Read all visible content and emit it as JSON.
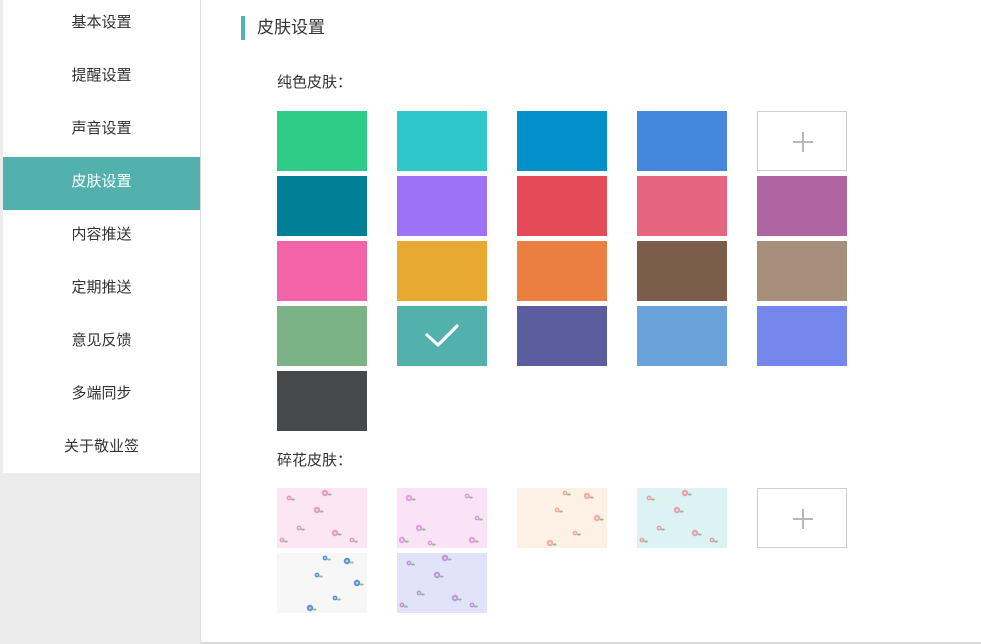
{
  "sidebar": {
    "items": [
      {
        "label": "基本设置",
        "active": false
      },
      {
        "label": "提醒设置",
        "active": false
      },
      {
        "label": "声音设置",
        "active": false
      },
      {
        "label": "皮肤设置",
        "active": true
      },
      {
        "label": "内容推送",
        "active": false
      },
      {
        "label": "定期推送",
        "active": false
      },
      {
        "label": "意见反馈",
        "active": false
      },
      {
        "label": "多端同步",
        "active": false
      },
      {
        "label": "关于敬业签",
        "active": false
      }
    ],
    "accent_color": "#52b1ad"
  },
  "main": {
    "title": "皮肤设置",
    "solid_section": {
      "label": "纯色皮肤：",
      "colors": [
        "#2ecc87",
        "#2fc7c9",
        "#028fca",
        "#4587dc",
        "add",
        "#007f97",
        "#9e71f5",
        "#e54b57",
        "#e5647f",
        "#ae65a1",
        "#f264a7",
        "#e8a933",
        "#eb7e41",
        "#7b5d4a",
        "#a88f7b",
        "#7bb286",
        "#52b1ad",
        "#5b5d9f",
        "#6aa2dc",
        "#7587ec",
        "#48494b"
      ],
      "selected_color": "#52b1ad"
    },
    "floral_section": {
      "label": "碎花皮肤：",
      "skins": [
        {
          "name": "pink-rose",
          "bg": "#fce6f3",
          "flower": "#e88bab"
        },
        {
          "name": "lilac-rose",
          "bg": "#fae3f7",
          "flower": "#d990d8"
        },
        {
          "name": "peach-blossom",
          "bg": "#fdf1e6",
          "flower": "#eea08c"
        },
        {
          "name": "mint-rose",
          "bg": "#dcf2f3",
          "flower": "#ec8ea2"
        },
        {
          "name": "add"
        },
        {
          "name": "blue-butterfly",
          "bg": "#f6f7f6",
          "flower": "#3d7fd0"
        },
        {
          "name": "lavender-rose",
          "bg": "#e3e2fb",
          "flower": "#b387d6"
        }
      ]
    }
  }
}
